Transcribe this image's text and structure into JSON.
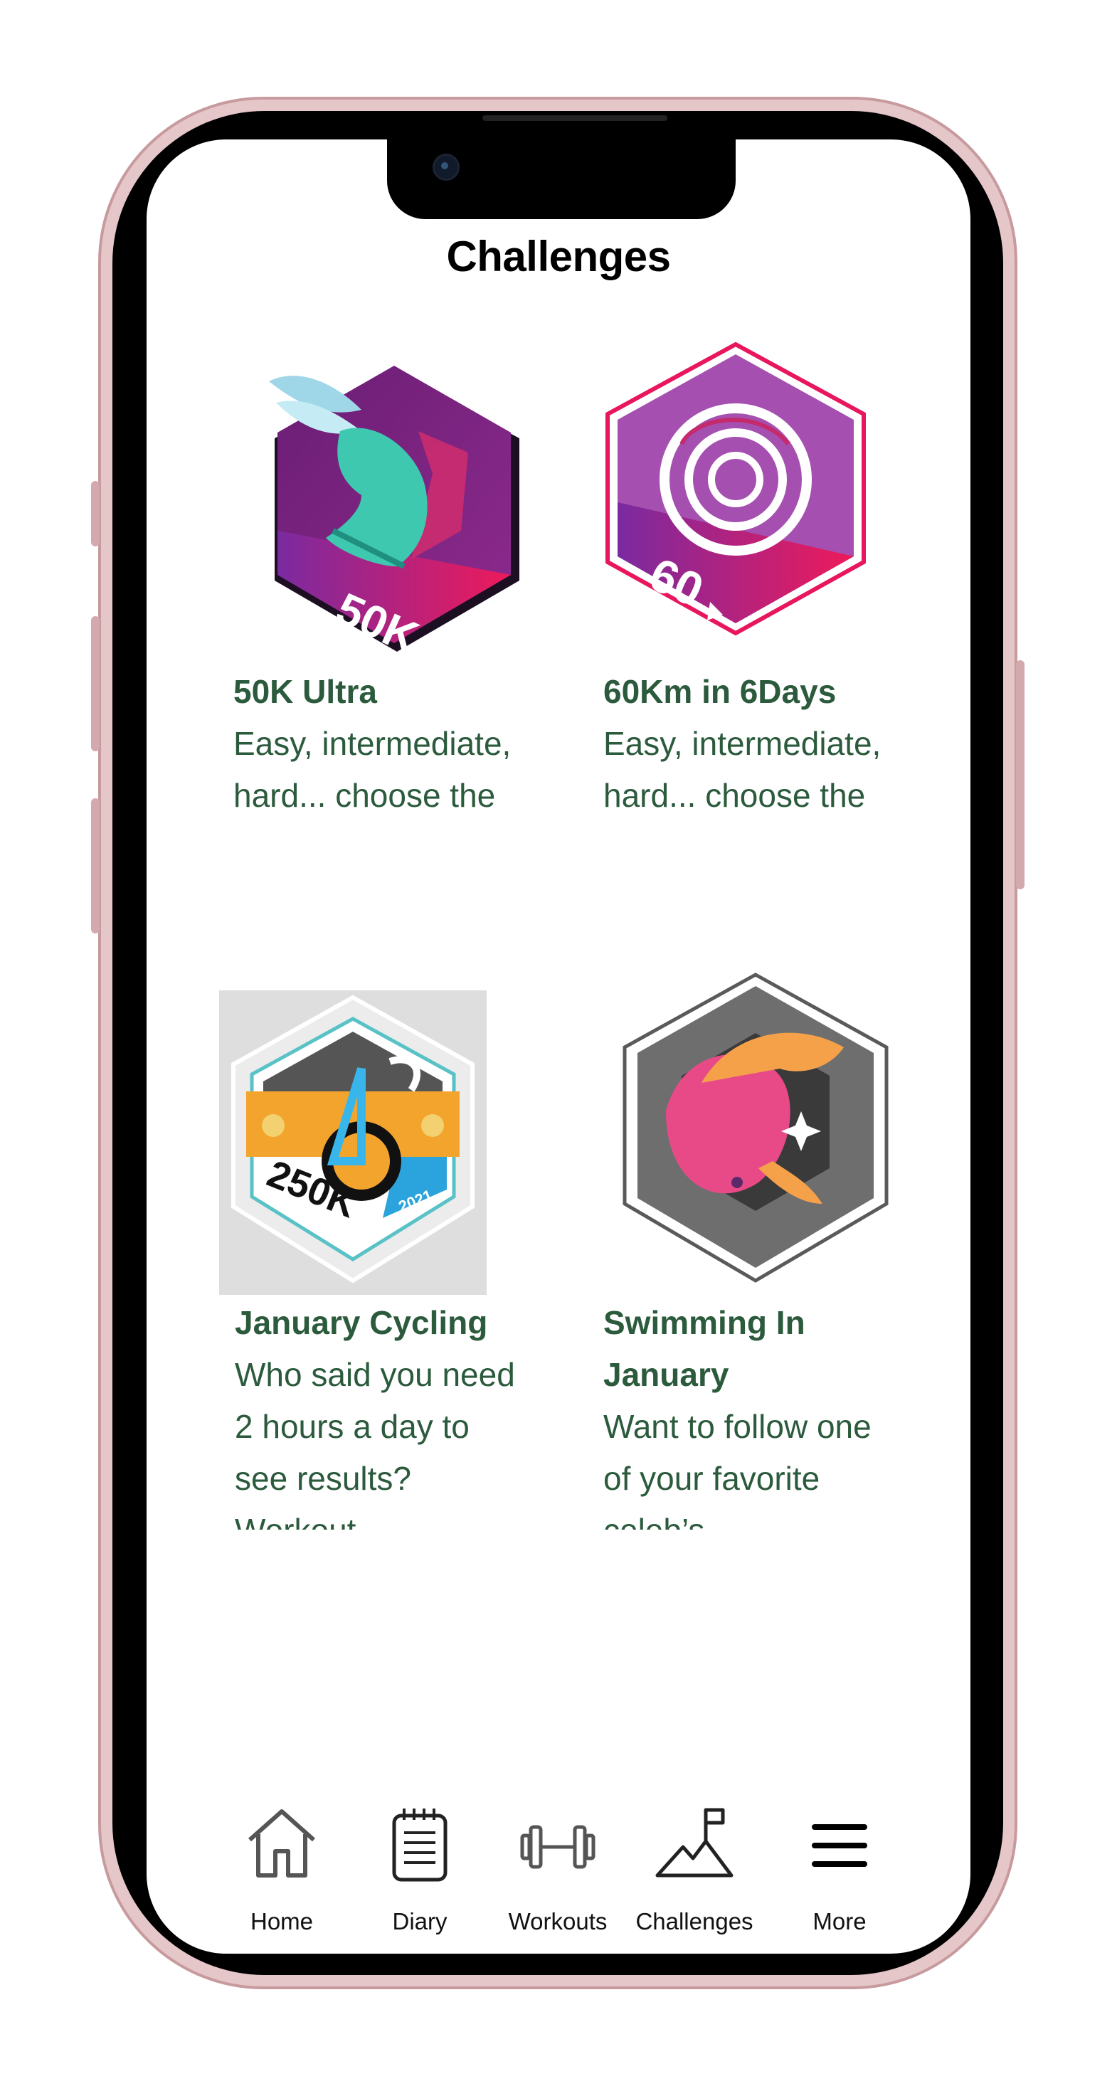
{
  "header": {
    "title": "Challenges"
  },
  "challenges": [
    {
      "title": "50K Ultra",
      "description": "Easy, intermediate, hard... choose the",
      "badge_icon": "winged-shoe-50k-badge",
      "badge_text": "50K"
    },
    {
      "title": "60Km in 6Days",
      "description": "Easy, intermediate, hard... choose the",
      "badge_icon": "target-60-badge",
      "badge_text": "60"
    },
    {
      "title": "January Cycling",
      "description": "Who said you need 2 hours a day to see results? Workout",
      "badge_icon": "bicycle-250k-badge",
      "badge_text": "250K",
      "badge_year": "2021"
    },
    {
      "title": "Swimming In January",
      "description": "Want to follow one of your favorite celeb’s",
      "badge_icon": "fish-badge"
    }
  ],
  "tabs": [
    {
      "label": "Home",
      "icon": "home-icon"
    },
    {
      "label": "Diary",
      "icon": "notepad-icon"
    },
    {
      "label": "Workouts",
      "icon": "dumbbell-icon"
    },
    {
      "label": "Challenges",
      "icon": "mountain-flag-icon"
    },
    {
      "label": "More",
      "icon": "menu-icon"
    }
  ],
  "colors": {
    "frame": "#d4a9ad",
    "bezel": "#000000",
    "title_green": "#2b5a3c",
    "accent_purple": "#7c2b8d",
    "accent_pink": "#e8175d"
  }
}
